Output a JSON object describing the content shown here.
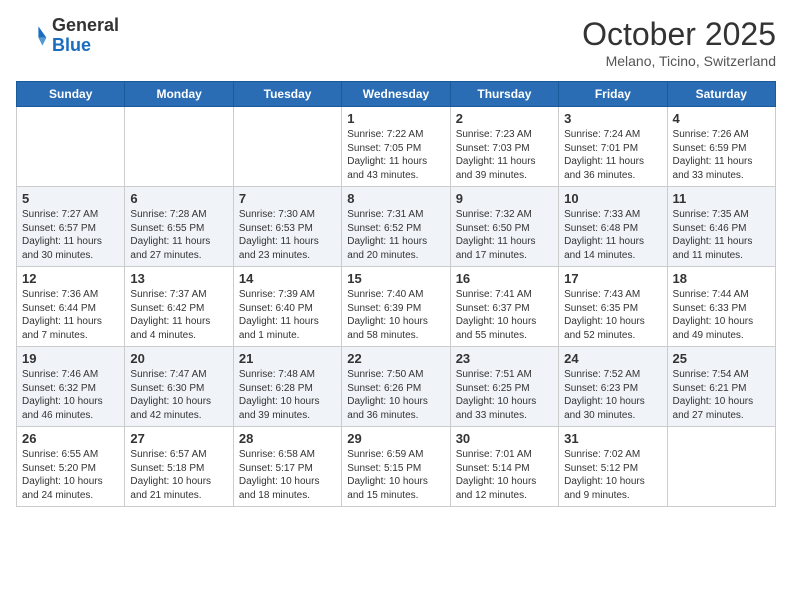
{
  "header": {
    "logo_general": "General",
    "logo_blue": "Blue",
    "month_title": "October 2025",
    "location": "Melano, Ticino, Switzerland"
  },
  "days_of_week": [
    "Sunday",
    "Monday",
    "Tuesday",
    "Wednesday",
    "Thursday",
    "Friday",
    "Saturday"
  ],
  "weeks": [
    [
      {
        "num": "",
        "info": ""
      },
      {
        "num": "",
        "info": ""
      },
      {
        "num": "",
        "info": ""
      },
      {
        "num": "1",
        "info": "Sunrise: 7:22 AM\nSunset: 7:05 PM\nDaylight: 11 hours and 43 minutes."
      },
      {
        "num": "2",
        "info": "Sunrise: 7:23 AM\nSunset: 7:03 PM\nDaylight: 11 hours and 39 minutes."
      },
      {
        "num": "3",
        "info": "Sunrise: 7:24 AM\nSunset: 7:01 PM\nDaylight: 11 hours and 36 minutes."
      },
      {
        "num": "4",
        "info": "Sunrise: 7:26 AM\nSunset: 6:59 PM\nDaylight: 11 hours and 33 minutes."
      }
    ],
    [
      {
        "num": "5",
        "info": "Sunrise: 7:27 AM\nSunset: 6:57 PM\nDaylight: 11 hours and 30 minutes."
      },
      {
        "num": "6",
        "info": "Sunrise: 7:28 AM\nSunset: 6:55 PM\nDaylight: 11 hours and 27 minutes."
      },
      {
        "num": "7",
        "info": "Sunrise: 7:30 AM\nSunset: 6:53 PM\nDaylight: 11 hours and 23 minutes."
      },
      {
        "num": "8",
        "info": "Sunrise: 7:31 AM\nSunset: 6:52 PM\nDaylight: 11 hours and 20 minutes."
      },
      {
        "num": "9",
        "info": "Sunrise: 7:32 AM\nSunset: 6:50 PM\nDaylight: 11 hours and 17 minutes."
      },
      {
        "num": "10",
        "info": "Sunrise: 7:33 AM\nSunset: 6:48 PM\nDaylight: 11 hours and 14 minutes."
      },
      {
        "num": "11",
        "info": "Sunrise: 7:35 AM\nSunset: 6:46 PM\nDaylight: 11 hours and 11 minutes."
      }
    ],
    [
      {
        "num": "12",
        "info": "Sunrise: 7:36 AM\nSunset: 6:44 PM\nDaylight: 11 hours and 7 minutes."
      },
      {
        "num": "13",
        "info": "Sunrise: 7:37 AM\nSunset: 6:42 PM\nDaylight: 11 hours and 4 minutes."
      },
      {
        "num": "14",
        "info": "Sunrise: 7:39 AM\nSunset: 6:40 PM\nDaylight: 11 hours and 1 minute."
      },
      {
        "num": "15",
        "info": "Sunrise: 7:40 AM\nSunset: 6:39 PM\nDaylight: 10 hours and 58 minutes."
      },
      {
        "num": "16",
        "info": "Sunrise: 7:41 AM\nSunset: 6:37 PM\nDaylight: 10 hours and 55 minutes."
      },
      {
        "num": "17",
        "info": "Sunrise: 7:43 AM\nSunset: 6:35 PM\nDaylight: 10 hours and 52 minutes."
      },
      {
        "num": "18",
        "info": "Sunrise: 7:44 AM\nSunset: 6:33 PM\nDaylight: 10 hours and 49 minutes."
      }
    ],
    [
      {
        "num": "19",
        "info": "Sunrise: 7:46 AM\nSunset: 6:32 PM\nDaylight: 10 hours and 46 minutes."
      },
      {
        "num": "20",
        "info": "Sunrise: 7:47 AM\nSunset: 6:30 PM\nDaylight: 10 hours and 42 minutes."
      },
      {
        "num": "21",
        "info": "Sunrise: 7:48 AM\nSunset: 6:28 PM\nDaylight: 10 hours and 39 minutes."
      },
      {
        "num": "22",
        "info": "Sunrise: 7:50 AM\nSunset: 6:26 PM\nDaylight: 10 hours and 36 minutes."
      },
      {
        "num": "23",
        "info": "Sunrise: 7:51 AM\nSunset: 6:25 PM\nDaylight: 10 hours and 33 minutes."
      },
      {
        "num": "24",
        "info": "Sunrise: 7:52 AM\nSunset: 6:23 PM\nDaylight: 10 hours and 30 minutes."
      },
      {
        "num": "25",
        "info": "Sunrise: 7:54 AM\nSunset: 6:21 PM\nDaylight: 10 hours and 27 minutes."
      }
    ],
    [
      {
        "num": "26",
        "info": "Sunrise: 6:55 AM\nSunset: 5:20 PM\nDaylight: 10 hours and 24 minutes."
      },
      {
        "num": "27",
        "info": "Sunrise: 6:57 AM\nSunset: 5:18 PM\nDaylight: 10 hours and 21 minutes."
      },
      {
        "num": "28",
        "info": "Sunrise: 6:58 AM\nSunset: 5:17 PM\nDaylight: 10 hours and 18 minutes."
      },
      {
        "num": "29",
        "info": "Sunrise: 6:59 AM\nSunset: 5:15 PM\nDaylight: 10 hours and 15 minutes."
      },
      {
        "num": "30",
        "info": "Sunrise: 7:01 AM\nSunset: 5:14 PM\nDaylight: 10 hours and 12 minutes."
      },
      {
        "num": "31",
        "info": "Sunrise: 7:02 AM\nSunset: 5:12 PM\nDaylight: 10 hours and 9 minutes."
      },
      {
        "num": "",
        "info": ""
      }
    ]
  ]
}
